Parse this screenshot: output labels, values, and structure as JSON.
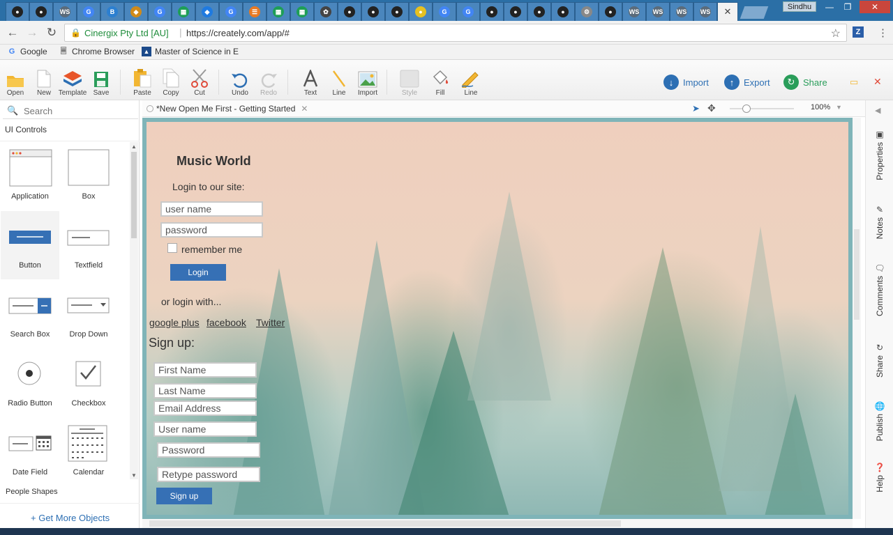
{
  "browser": {
    "tabs": [
      {
        "icon": "github-icon",
        "color": "#222222"
      },
      {
        "icon": "github-icon",
        "color": "#222222"
      },
      {
        "icon": "ws-icon",
        "color": "#5b6b7a"
      },
      {
        "icon": "google-icon",
        "color": "#4285f4"
      },
      {
        "icon": "b-icon",
        "color": "#2c7fd0"
      },
      {
        "icon": "shield-icon",
        "color": "#d08a1a"
      },
      {
        "icon": "google-icon",
        "color": "#4285f4"
      },
      {
        "icon": "sheets-icon",
        "color": "#1e9e57"
      },
      {
        "icon": "dropbox-icon",
        "color": "#1f7ae0"
      },
      {
        "icon": "google-icon",
        "color": "#4285f4"
      },
      {
        "icon": "stack-icon",
        "color": "#e87922"
      },
      {
        "icon": "sheets-icon",
        "color": "#1e9e57"
      },
      {
        "icon": "sheets-icon",
        "color": "#1e9e57"
      },
      {
        "icon": "bird-icon",
        "color": "#444444"
      },
      {
        "icon": "github-icon",
        "color": "#222222"
      },
      {
        "icon": "github-icon",
        "color": "#222222"
      },
      {
        "icon": "github-icon",
        "color": "#222222"
      },
      {
        "icon": "bulb-icon",
        "color": "#e6c020"
      },
      {
        "icon": "google-icon",
        "color": "#4285f4"
      },
      {
        "icon": "google-icon",
        "color": "#4285f4"
      },
      {
        "icon": "github-icon",
        "color": "#222222"
      },
      {
        "icon": "github-icon",
        "color": "#222222"
      },
      {
        "icon": "github-icon",
        "color": "#222222"
      },
      {
        "icon": "github-icon",
        "color": "#222222"
      },
      {
        "icon": "gear-icon",
        "color": "#888888"
      },
      {
        "icon": "github-icon",
        "color": "#222222"
      },
      {
        "icon": "ws-icon",
        "color": "#5b6b7a"
      },
      {
        "icon": "ws-icon",
        "color": "#5b6b7a"
      },
      {
        "icon": "ws-icon",
        "color": "#5b6b7a"
      },
      {
        "icon": "ws-icon",
        "color": "#5b6b7a"
      }
    ],
    "user": "Sindhu",
    "site_name": "Cinergix Pty Ltd [AU]",
    "url": "https://creately.com/app/#",
    "bookmarks": [
      "Google",
      "Chrome Browser",
      "Master of Science in E"
    ]
  },
  "toolbar": {
    "open": "Open",
    "new": "New",
    "template": "Template",
    "save": "Save",
    "paste": "Paste",
    "copy": "Copy",
    "cut": "Cut",
    "undo": "Undo",
    "redo": "Redo",
    "text": "Text",
    "line": "Line",
    "import_img": "Import",
    "style": "Style",
    "fill": "Fill",
    "line2": "Line",
    "import_btn": "Import",
    "export_btn": "Export",
    "share_btn": "Share"
  },
  "panel": {
    "search_placeholder": "Search",
    "section": "UI Controls",
    "shapes": [
      "Application",
      "Box",
      "Button",
      "Textfield",
      "Search Box",
      "Drop Down",
      "Radio Button",
      "Checkbox",
      "Date Field",
      "Calendar"
    ],
    "people": "People Shapes",
    "get_more": "+ Get More Objects"
  },
  "document": {
    "tab_title": "*New Open Me First - Getting Started",
    "zoom": "100%"
  },
  "mockup": {
    "title": "Music World",
    "login_prompt": "Login to our site:",
    "username": "user name",
    "password": "password",
    "remember": "remember me",
    "login_btn": "Login",
    "or_login": "or login with...",
    "links": [
      "google plus",
      "facebook",
      "Twitter"
    ],
    "signup_heading": "Sign up:",
    "signup_fields": [
      "First Name",
      "Last Name",
      "Email Address",
      "User name",
      "Password",
      "Retype password"
    ],
    "signup_btn": "Sign up"
  },
  "rightrail": [
    "Properties",
    "Notes",
    "Comments",
    "Share",
    "Publish",
    "Help"
  ]
}
